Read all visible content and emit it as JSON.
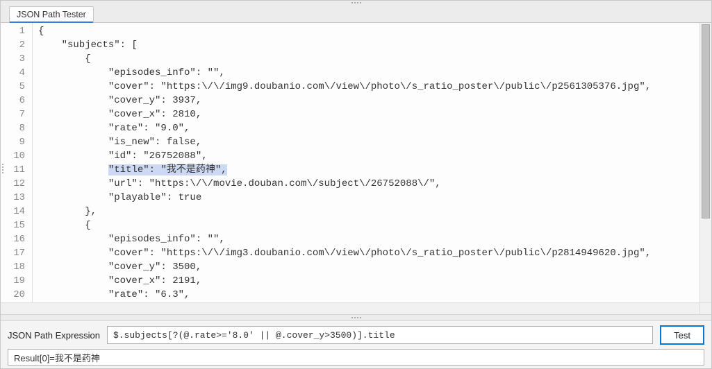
{
  "tab": {
    "title": "JSON Path Tester"
  },
  "editor": {
    "highlighted_line_index": 10,
    "lines": [
      "{",
      "    \"subjects\": [",
      "        {",
      "            \"episodes_info\": \"\",",
      "            \"cover\": \"https:\\/\\/img9.doubanio.com\\/view\\/photo\\/s_ratio_poster\\/public\\/p2561305376.jpg\",",
      "            \"cover_y\": 3937,",
      "            \"cover_x\": 2810,",
      "            \"rate\": \"9.0\",",
      "            \"is_new\": false,",
      "            \"id\": \"26752088\",",
      "            \"title\": \"我不是药神\",",
      "            \"url\": \"https:\\/\\/movie.douban.com\\/subject\\/26752088\\/\",",
      "            \"playable\": true",
      "        },",
      "        {",
      "            \"episodes_info\": \"\",",
      "            \"cover\": \"https:\\/\\/img3.doubanio.com\\/view\\/photo\\/s_ratio_poster\\/public\\/p2814949620.jpg\",",
      "            \"cover_y\": 3500,",
      "            \"cover_x\": 2191,",
      "            \"rate\": \"6.3\","
    ]
  },
  "bottom": {
    "expression_label": "JSON Path Expression",
    "expression_value": "$.subjects[?(@.rate>='8.0' || @.cover_y>3500)].title",
    "test_button": "Test",
    "result_text": "Result[0]=我不是药神"
  }
}
